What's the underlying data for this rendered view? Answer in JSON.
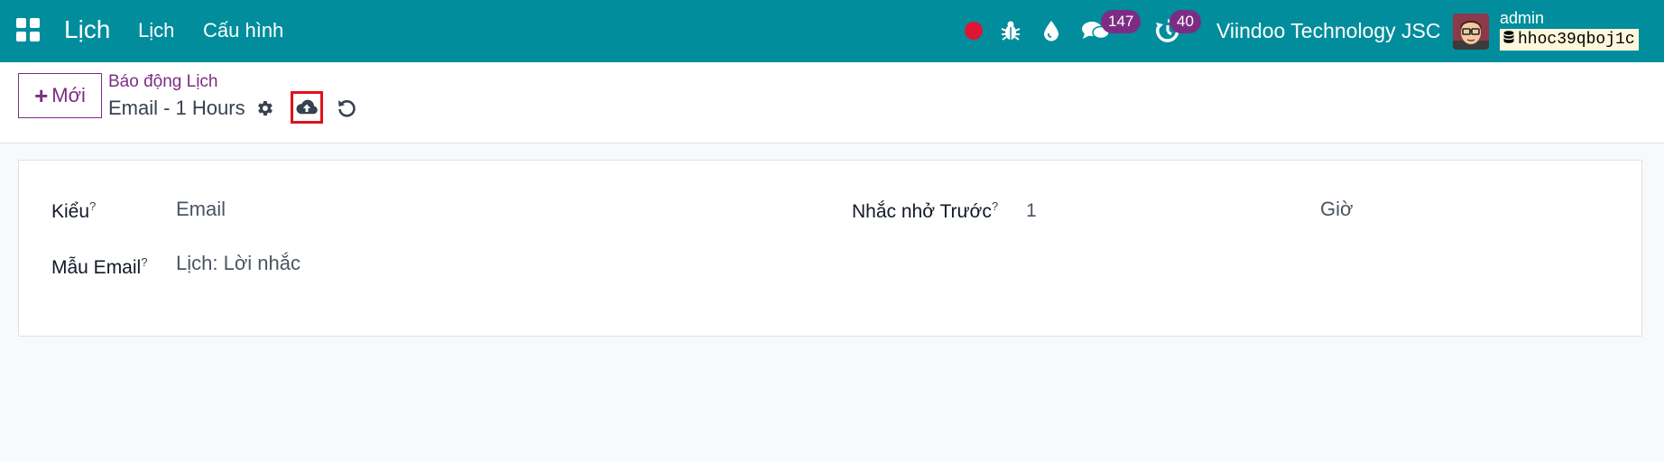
{
  "navbar": {
    "brand": "Lịch",
    "menu": [
      "Lịch",
      "Cấu hình"
    ],
    "icons": [
      "apps-icon",
      "record-icon",
      "bug-icon",
      "drop-icon",
      "chat-icon",
      "clock-icon"
    ],
    "chat_badge": "147",
    "activity_badge": "40",
    "company": "Viindoo Technology JSC",
    "user": "admin",
    "database": "hhoc39qboj1c",
    "colors": {
      "navbar_bg": "#018d9c",
      "badge_bg": "#7c2d83",
      "record_dot": "#dc1633"
    }
  },
  "control_panel": {
    "new_button_label": "Mới",
    "breadcrumb": "Báo động Lịch",
    "record_title": "Email - 1 Hours",
    "icons": [
      "gear-icon",
      "cloud-upload-icon",
      "undo-icon"
    ],
    "colors": {
      "accent": "#7c2d83",
      "save_highlight": "#e0101e"
    }
  },
  "form": {
    "type_label": "Kiểu",
    "type_value": "Email",
    "remind_before_label": "Nhắc nhở Trước",
    "remind_before_value": "1",
    "remind_unit": "Giờ",
    "template_label": "Mẫu Email",
    "template_value": "Lịch: Lời nhắc",
    "help_mark": "?"
  }
}
